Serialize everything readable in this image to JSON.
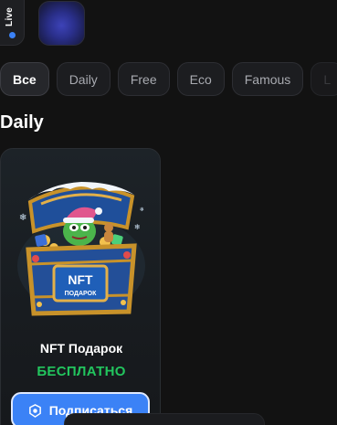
{
  "stories": {
    "live_label": "Live",
    "live_dot_color": "#3b82f6"
  },
  "filters": {
    "selected": "Все",
    "items": [
      {
        "label": "Все"
      },
      {
        "label": "Daily"
      },
      {
        "label": "Free"
      },
      {
        "label": "Eco"
      },
      {
        "label": "Famous"
      },
      {
        "label": "L"
      }
    ]
  },
  "section": {
    "title": "Daily"
  },
  "card": {
    "title": "NFT Подарок",
    "price": "БЕСПЛАТНО",
    "price_color": "#22c55e",
    "chest_plaque_top": "NFT",
    "chest_plaque_bottom": "ПОДАРОК",
    "image_icon": "treasure-chest-image",
    "button_label": "Подписаться",
    "button_icon": "shield-check-icon",
    "button_color": "#3b82f6"
  }
}
